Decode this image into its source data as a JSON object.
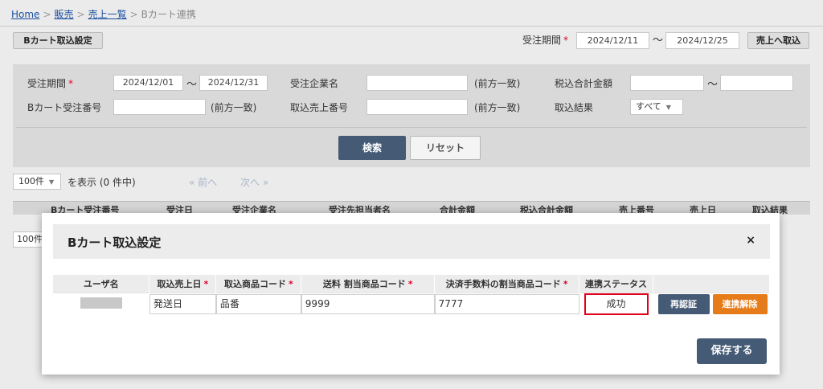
{
  "breadcrumb": {
    "home": "Home",
    "sales": "販売",
    "sales_list": "売上一覧",
    "current": "Bカート連携",
    "sep": ">"
  },
  "toolbar": {
    "bcart_setting_label": "Bカート取込設定",
    "period_label": "受注期間",
    "required_mark": "*",
    "period_from": "2024/12/11",
    "tilde": "～",
    "period_to": "2024/12/25",
    "to_sales_label": "売上へ取込"
  },
  "search": {
    "order_period_label": "受注期間",
    "order_from": "2024/12/01",
    "order_to": "2024/12/31",
    "company_label": "受注企業名",
    "company_value": "",
    "partial_match": "(前方一致)",
    "total_tax_label": "税込合計金額",
    "total_from": "",
    "total_to": "",
    "bcart_order_no_label": "Bカート受注番号",
    "bcart_order_no_value": "",
    "import_sales_no_label": "取込売上番号",
    "import_sales_no_value": "",
    "import_result_label": "取込結果",
    "import_result_value": "すべて",
    "search_button": "検索",
    "reset_button": "リセット"
  },
  "list": {
    "page_size": "100件",
    "per_page_text": "を表示 (0 件中)",
    "prev": "« 前へ",
    "next": "次へ »",
    "columns": [
      "Bカート受注番号",
      "受注日",
      "受注企業名",
      "受注先担当者名",
      "合計金額",
      "税込合計金額",
      "売上番号",
      "売上日",
      "取込結果"
    ],
    "page_size_bottom": "100件"
  },
  "modal": {
    "title": "Bカート取込設定",
    "close": "×",
    "columns": {
      "user": "ユーザ名",
      "import_date": "取込売上日",
      "product_code": "取込商品コード",
      "shipping_code": "送料 割当商品コード",
      "fee_code": "決済手数料の割当商品コード",
      "status": "連携ステータス"
    },
    "row": {
      "import_date": "発送日",
      "product_code": "品番",
      "shipping_code": "9999",
      "fee_code": "7777",
      "status": "成功",
      "reauth_button": "再認証",
      "unlink_button": "連携解除"
    },
    "save_button": "保存する"
  }
}
